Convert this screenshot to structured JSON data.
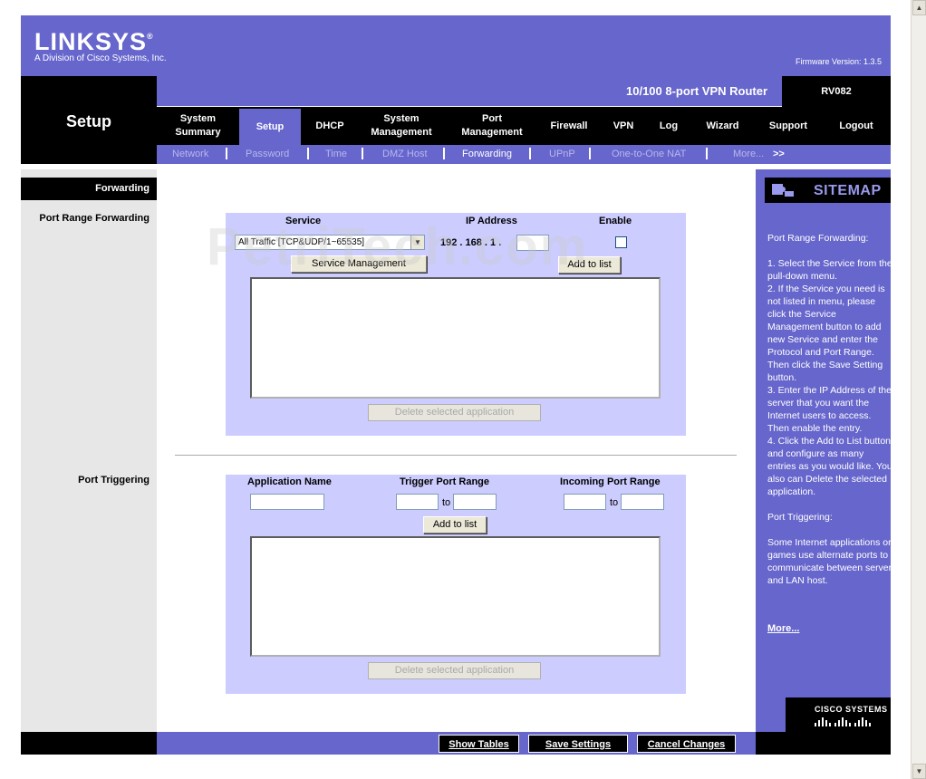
{
  "header": {
    "brand": "LINKSYS",
    "brand_mark": "®",
    "tagline": "A Division of Cisco Systems, Inc.",
    "firmware": "Firmware Version: 1.3.5"
  },
  "product": {
    "name": "10/100 8-port VPN Router",
    "model": "RV082"
  },
  "section_title": "Setup",
  "main_nav": [
    {
      "label": "System Summary",
      "active": false
    },
    {
      "label": "Setup",
      "active": true
    },
    {
      "label": "DHCP",
      "active": false
    },
    {
      "label": "System Management",
      "active": false
    },
    {
      "label": "Port Management",
      "active": false
    },
    {
      "label": "Firewall",
      "active": false
    },
    {
      "label": "VPN",
      "active": false
    },
    {
      "label": "Log",
      "active": false
    },
    {
      "label": "Wizard",
      "active": false
    },
    {
      "label": "Support",
      "active": false
    },
    {
      "label": "Logout",
      "active": false
    }
  ],
  "sub_nav": [
    {
      "label": "Network"
    },
    {
      "label": "Password"
    },
    {
      "label": "Time"
    },
    {
      "label": "DMZ Host"
    },
    {
      "label": "Forwarding",
      "active": true
    },
    {
      "label": "UPnP"
    },
    {
      "label": "One-to-One NAT"
    },
    {
      "label": "More..."
    }
  ],
  "sub_nav_more_arrows": ">>",
  "left": {
    "heading": "Forwarding",
    "port_range_forwarding": "Port Range Forwarding",
    "port_triggering": "Port Triggering"
  },
  "watermark": "PetriTech.com",
  "prf": {
    "col_service": "Service",
    "col_ip": "IP Address",
    "col_enable": "Enable",
    "service_selected": "All Traffic [TCP&UDP/1~65535]",
    "ip_prefix": "192 . 168 . 1 .",
    "ip_last": "",
    "enable_checked": false,
    "service_mgmt_btn": "Service Management",
    "add_btn": "Add to list",
    "delete_btn": "Delete selected application"
  },
  "pt": {
    "col_app": "Application Name",
    "col_trigger": "Trigger Port Range",
    "col_incoming": "Incoming Port Range",
    "to1": "to",
    "to2": "to",
    "add_btn": "Add to list",
    "delete_btn": "Delete selected application"
  },
  "sitemap": {
    "title": "SITEMAP",
    "help": "Port Range Forwarding:\n\n1. Select the Service from the pull-down menu.\n2. If the Service you need is not listed in menu, please click the Service Management button to add new Service and enter the Protocol and Port Range. Then click the Save Setting button.\n3. Enter the IP Address of the server that you want the Internet users to access. Then enable the entry.\n4. Click the Add to List button, and configure as many entries as you would like. You also can Delete the selected application.\n\nPort Triggering:\n\nSome Internet applications or games use alternate ports to communicate between server and LAN host.",
    "more": "More...",
    "cisco": "CISCO SYSTEMS"
  },
  "footer": {
    "show_tables": "Show Tables",
    "save_settings": "Save Settings",
    "cancel_changes": "Cancel Changes"
  },
  "colors": {
    "brand_purple": "#6666cc",
    "panel_lavender": "#ccccff",
    "black": "#000000"
  }
}
